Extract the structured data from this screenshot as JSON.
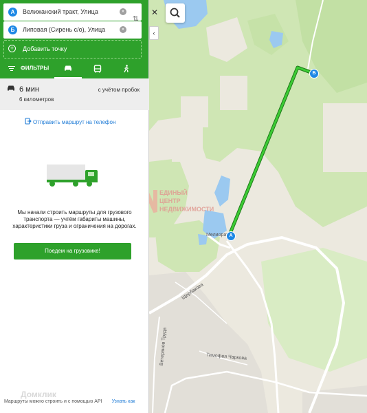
{
  "route": {
    "point_a": {
      "badge": "А",
      "value": "Велижанский тракт, Улица"
    },
    "point_b": {
      "badge": "Б",
      "value": "Липовая (Сирень с/о), Улица"
    },
    "add_point": "Добавить точку",
    "clear_glyph": "×",
    "swap_glyph": "⇅"
  },
  "tabs": {
    "filters": "ФИЛЬТРЫ",
    "modes": [
      "car",
      "bus",
      "walk"
    ],
    "active": "car"
  },
  "summary": {
    "duration": "6 мин",
    "distance": "6 километров",
    "traffic_note": "с учётом пробок"
  },
  "send_link": "Отправить маршрут на телефон",
  "truck_promo": {
    "text": "Мы начали строить маршруты для грузового транспорта — учтём габариты машины, характеристики груза и ограничения на дорогах.",
    "button": "Поедем на грузовике!"
  },
  "footer": {
    "api_text": "Маршруты можно строить и с помощью API",
    "link": "Узнать как",
    "watermark": "Домклик"
  },
  "map": {
    "labels": {
      "street_1": "Щербакова",
      "street_2": "Тимофея Чаркова",
      "street_3": "Ветеранов Труда",
      "place": "Мелиоратор"
    },
    "marker_a": "А",
    "marker_b": "Б",
    "watermark": {
      "line1": "ЕДИНЫЙ",
      "line2": "ЦЕНТР",
      "line3": "НЕДВИЖИМОСТИ"
    }
  },
  "controls": {
    "close": "✕",
    "collapse": "‹"
  },
  "colors": {
    "brand_green": "#2ea12b",
    "route_green": "#27a822",
    "link_blue": "#1e7bd6",
    "marker_blue": "#1e88e5"
  }
}
